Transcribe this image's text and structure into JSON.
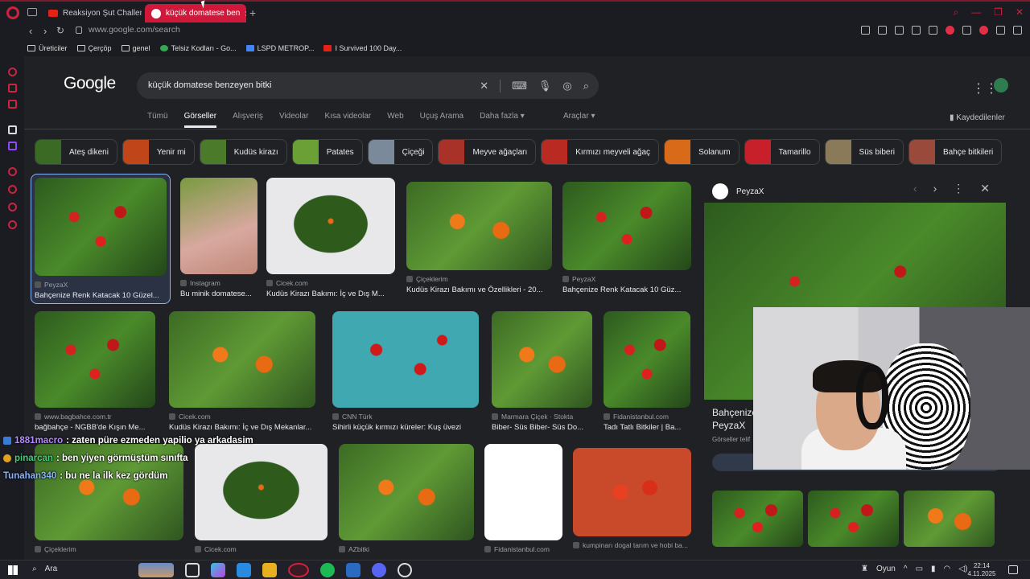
{
  "browser": {
    "tabs": [
      {
        "label": "Reaksiyon Şut Challenge!"
      },
      {
        "label": "küçük domatese ben"
      }
    ],
    "url": "www.google.com/search",
    "bookmarks": [
      "Üreticiler",
      "Çerçöp",
      "genel",
      "Telsiz Kodları - Go...",
      "LSPD METROP...",
      "I Survived 100 Day..."
    ]
  },
  "google": {
    "logo": "Google",
    "query": "küçük domatese benzeyen bitki",
    "nav_tabs": [
      "Tümü",
      "Görseller",
      "Alışveriş",
      "Videolar",
      "Kısa videolar",
      "Web",
      "Uçuş Arama",
      "Daha fazla"
    ],
    "more_arrow": "▾",
    "tools": "Araçlar ▾",
    "saved": "Kaydedilenler",
    "chips": [
      {
        "label": "Ateş dikeni",
        "color": "#3a6a24"
      },
      {
        "label": "Yenir mi",
        "color": "#c0461a"
      },
      {
        "label": "Kudüs kirazı",
        "color": "#4a7a2a"
      },
      {
        "label": "Patates",
        "color": "#6aa035"
      },
      {
        "label": "Çiçeği",
        "color": "#7a8a9a"
      },
      {
        "label": "Meyve ağaçları",
        "color": "#a83228"
      },
      {
        "label": "Kırmızı meyveli ağaç",
        "color": "#b82a22"
      },
      {
        "label": "Solanum",
        "color": "#d86a1a"
      },
      {
        "label": "Tamarillo",
        "color": "#c8202a"
      },
      {
        "label": "Süs biberi",
        "color": "#8a7a5a"
      },
      {
        "label": "Bahçe bitkileri",
        "color": "#9a4a3a"
      }
    ],
    "results": [
      {
        "source": "PeyzaX",
        "title": "Bahçenize Renk Katacak 10 Güzel..."
      },
      {
        "source": "Instagram",
        "title": "Bu minik domatese..."
      },
      {
        "source": "Cicek.com",
        "title": "Kudüs Kirazı Bakımı: İç ve Dış M..."
      },
      {
        "source": "Çiçeklerim",
        "title": "Kudüs Kirazı Bakımı ve Özellikleri - 20..."
      },
      {
        "source": "PeyzaX",
        "title": "Bahçenize Renk Katacak 10 Güz..."
      },
      {
        "source": "www.bagbahce.com.tr",
        "title": "bağbahçe - NGBB'de Kışın Me..."
      },
      {
        "source": "Cicek.com",
        "title": "Kudüs Kirazı Bakımı: İç ve Dış Mekanlar..."
      },
      {
        "source": "CNN Türk",
        "title": "Sihirli küçük kırmızı küreler: Kuş üvezi"
      },
      {
        "source": "Marmara Çiçek · Stokta",
        "title": "Biber- Süs Biber- Süs Do..."
      },
      {
        "source": "Fidanistanbul.com",
        "title": "Tadı Tatlı Bitkiler | Ba..."
      },
      {
        "source": "Çiçeklerim",
        "title": ""
      },
      {
        "source": "Cicek.com",
        "title": ""
      },
      {
        "source": "AZbitki",
        "title": ""
      },
      {
        "source": "Fidanistanbul.com",
        "title": ""
      },
      {
        "source": "kumpinarı dogal tarım ve hobi ba...",
        "title": ""
      }
    ],
    "preview": {
      "site": "PeyzaX",
      "title_line1": "Bahçenize",
      "title_line2": "PeyzaX",
      "sub": "Görseller telif"
    }
  },
  "chat": [
    {
      "user": "1881macro",
      "message": ": zaten püre ezmeden yapilio ya arkadasim"
    },
    {
      "user": "pinarcan",
      "message": ": ben yiyen görmüştüm sınıfta"
    },
    {
      "user": "Tunahan340",
      "message": ": bu ne la ilk kez gördüm"
    }
  ],
  "taskbar": {
    "search": "Ara",
    "game": "Oyun",
    "time": "22:14",
    "date": "4.11.2025"
  }
}
